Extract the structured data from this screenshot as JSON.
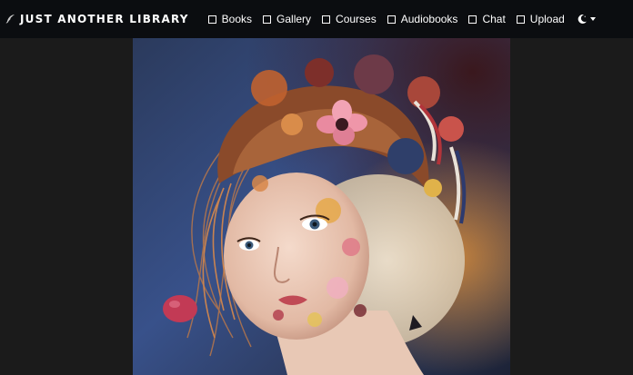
{
  "navbar": {
    "brand": "Just Another Library",
    "brand_icon": "feather-icon",
    "items": [
      {
        "label": "Books",
        "icon": "checkbox-icon"
      },
      {
        "label": "Gallery",
        "icon": "checkbox-icon"
      },
      {
        "label": "Courses",
        "icon": "checkbox-icon"
      },
      {
        "label": "Audiobooks",
        "icon": "checkbox-icon"
      },
      {
        "label": "Chat",
        "icon": "checkbox-icon"
      },
      {
        "label": "Upload",
        "icon": "checkbox-icon"
      }
    ],
    "theme_toggle_icon": "moon-icon"
  },
  "colors": {
    "navbar_bg": "#0b0d10",
    "page_bg": "#1b1b1b",
    "text": "#ffffff"
  }
}
